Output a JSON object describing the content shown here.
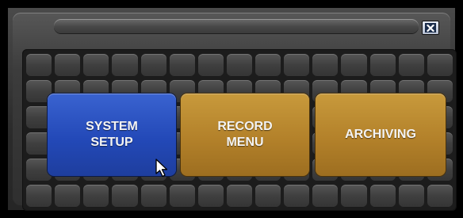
{
  "window": {
    "title": "",
    "close_icon": "close-x-icon"
  },
  "menu": {
    "buttons": [
      {
        "label": "SYSTEM\nSETUP",
        "color": "#2349b8",
        "state": "hovered"
      },
      {
        "label": "RECORD\nMENU",
        "color": "#b3812a",
        "state": "normal"
      },
      {
        "label": "ARCHIVING",
        "color": "#b3812a",
        "state": "normal"
      }
    ]
  },
  "colors": {
    "background": "#2f2f2f",
    "tile": "#454545",
    "selected": "#2349b8",
    "normal_button": "#b3812a"
  },
  "cursor": {
    "icon": "mouse-pointer-icon"
  }
}
